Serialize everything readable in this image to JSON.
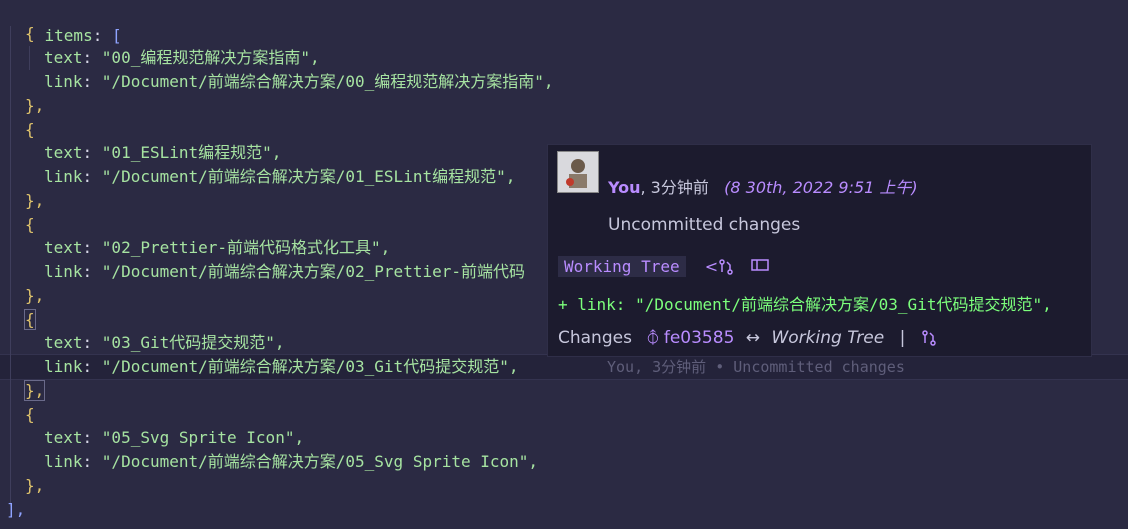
{
  "code": {
    "items_key": "items",
    "colon": ":",
    "open_bracket": "[",
    "close_bracket": "],",
    "open_brace": "{",
    "close_brace": "},",
    "text_key": "text",
    "link_key": "link",
    "entries": [
      {
        "text": "\"00_编程规范解决方案指南\",",
        "link": "\"/Document/前端综合解决方案/00_编程规范解决方案指南\","
      },
      {
        "text": "\"01_ESLint编程规范\",",
        "link": "\"/Document/前端综合解决方案/01_ESLint编程规范\","
      },
      {
        "text": "\"02_Prettier-前端代码格式化工具\",",
        "link": "\"/Document/前端综合解决方案/02_Prettier-前端代码"
      },
      {
        "text": "\"03_Git代码提交规范\",",
        "link": "\"/Document/前端综合解决方案/03_Git代码提交规范\","
      },
      {
        "text": "\"05_Svg Sprite Icon\",",
        "link": "\"/Document/前端综合解决方案/05_Svg Sprite Icon\","
      }
    ],
    "inline_blame": "You, 3分钟前 • Uncommitted changes"
  },
  "hover": {
    "author": "You",
    "relative_time": ", 3分钟前",
    "date": "(8 30th, 2022 9:51 上午)",
    "message": "Uncommitted changes",
    "badge": "Working Tree",
    "diff_line": "+ link: \"/Document/前端综合解决方案/03_Git代码提交规范\",",
    "changes_label": "Changes",
    "sha": "fe03585",
    "arrow": "↔",
    "target": "Working Tree",
    "separator": "|"
  }
}
